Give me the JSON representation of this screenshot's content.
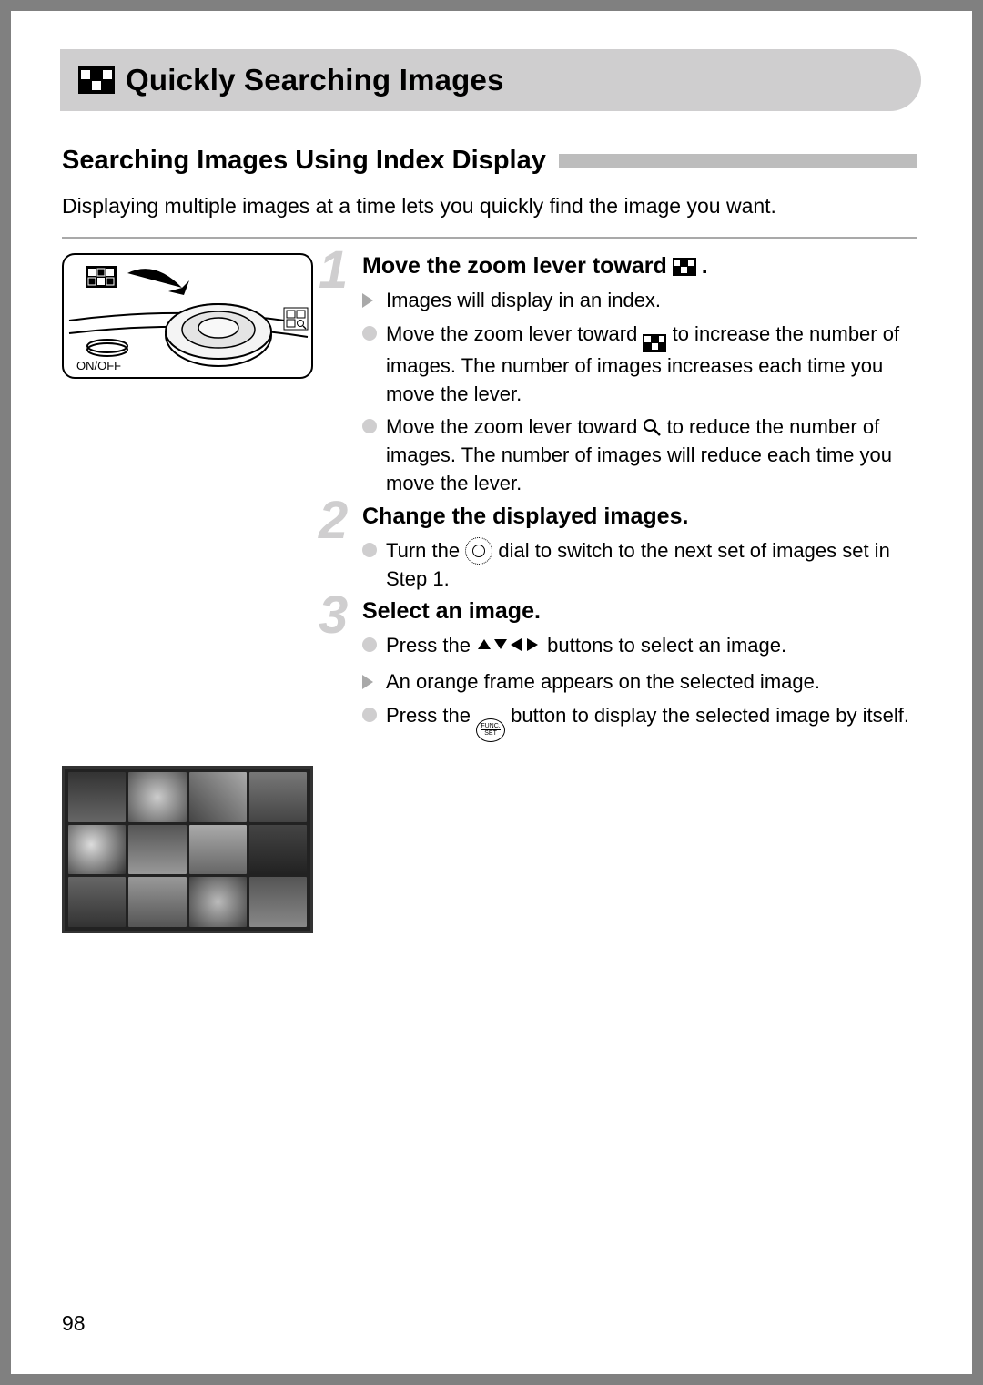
{
  "title": "Quickly Searching Images",
  "subhead": "Searching Images Using Index Display",
  "intro": "Displaying multiple images at a time lets you quickly find the image you want.",
  "diagram": {
    "onoff_label": "ON/OFF"
  },
  "steps": [
    {
      "num": "1",
      "heading_pre": "Move the zoom lever toward ",
      "heading_post": ".",
      "bullets": [
        {
          "marker": "tri",
          "text": "Images will display in an index."
        },
        {
          "marker": "dot",
          "pre": "Move the zoom lever toward ",
          "icon": "index",
          "post": " to increase the number of images. The number of images increases each time you move the lever."
        },
        {
          "marker": "dot",
          "pre": "Move the zoom lever toward ",
          "icon": "magnify",
          "post": " to reduce the number of images. The number of images will reduce each time you move the lever."
        }
      ]
    },
    {
      "num": "2",
      "heading": "Change the displayed images.",
      "bullets": [
        {
          "marker": "dot",
          "pre": "Turn the ",
          "icon": "dial",
          "post": " dial to switch to the next set of images set in Step 1."
        }
      ]
    },
    {
      "num": "3",
      "heading": "Select an image.",
      "bullets": [
        {
          "marker": "dot",
          "pre": "Press the ",
          "icon": "arrows",
          "post": " buttons to select an image."
        },
        {
          "marker": "tri",
          "text": "An orange frame appears on the selected image."
        },
        {
          "marker": "dot",
          "pre": "Press the ",
          "icon": "func",
          "post": " button to display the selected image by itself."
        }
      ]
    }
  ],
  "func_button": {
    "top": "FUNC.",
    "bottom": "SET"
  },
  "page_number": "98"
}
